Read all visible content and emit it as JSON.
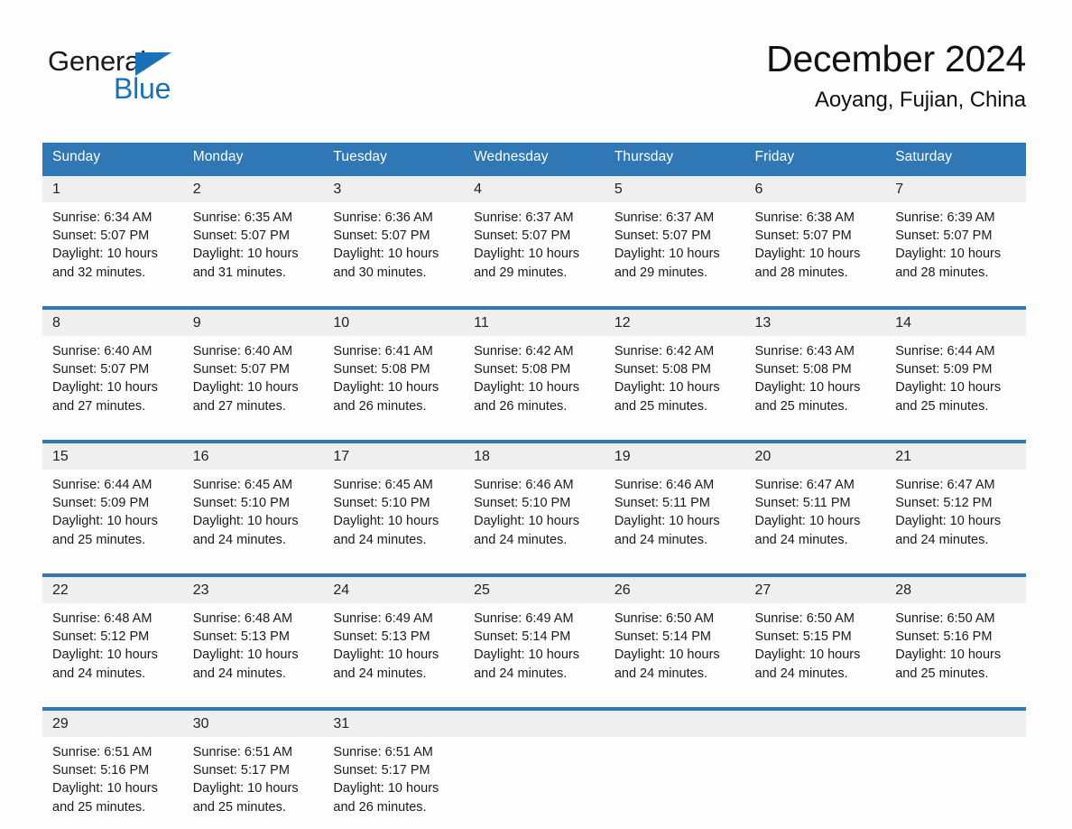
{
  "brand": {
    "name_part1": "General",
    "name_part2": "Blue",
    "accent_color": "#1a71b8"
  },
  "header": {
    "title": "December 2024",
    "location": "Aoyang, Fujian, China"
  },
  "calendar": {
    "header_bg_color": "#2f77b5",
    "daynum_bg_color": "#efefef",
    "weekdays": [
      "Sunday",
      "Monday",
      "Tuesday",
      "Wednesday",
      "Thursday",
      "Friday",
      "Saturday"
    ],
    "weeks": [
      [
        {
          "day": "1",
          "sunrise": "Sunrise: 6:34 AM",
          "sunset": "Sunset: 5:07 PM",
          "daylight": "Daylight: 10 hours and 32 minutes."
        },
        {
          "day": "2",
          "sunrise": "Sunrise: 6:35 AM",
          "sunset": "Sunset: 5:07 PM",
          "daylight": "Daylight: 10 hours and 31 minutes."
        },
        {
          "day": "3",
          "sunrise": "Sunrise: 6:36 AM",
          "sunset": "Sunset: 5:07 PM",
          "daylight": "Daylight: 10 hours and 30 minutes."
        },
        {
          "day": "4",
          "sunrise": "Sunrise: 6:37 AM",
          "sunset": "Sunset: 5:07 PM",
          "daylight": "Daylight: 10 hours and 29 minutes."
        },
        {
          "day": "5",
          "sunrise": "Sunrise: 6:37 AM",
          "sunset": "Sunset: 5:07 PM",
          "daylight": "Daylight: 10 hours and 29 minutes."
        },
        {
          "day": "6",
          "sunrise": "Sunrise: 6:38 AM",
          "sunset": "Sunset: 5:07 PM",
          "daylight": "Daylight: 10 hours and 28 minutes."
        },
        {
          "day": "7",
          "sunrise": "Sunrise: 6:39 AM",
          "sunset": "Sunset: 5:07 PM",
          "daylight": "Daylight: 10 hours and 28 minutes."
        }
      ],
      [
        {
          "day": "8",
          "sunrise": "Sunrise: 6:40 AM",
          "sunset": "Sunset: 5:07 PM",
          "daylight": "Daylight: 10 hours and 27 minutes."
        },
        {
          "day": "9",
          "sunrise": "Sunrise: 6:40 AM",
          "sunset": "Sunset: 5:07 PM",
          "daylight": "Daylight: 10 hours and 27 minutes."
        },
        {
          "day": "10",
          "sunrise": "Sunrise: 6:41 AM",
          "sunset": "Sunset: 5:08 PM",
          "daylight": "Daylight: 10 hours and 26 minutes."
        },
        {
          "day": "11",
          "sunrise": "Sunrise: 6:42 AM",
          "sunset": "Sunset: 5:08 PM",
          "daylight": "Daylight: 10 hours and 26 minutes."
        },
        {
          "day": "12",
          "sunrise": "Sunrise: 6:42 AM",
          "sunset": "Sunset: 5:08 PM",
          "daylight": "Daylight: 10 hours and 25 minutes."
        },
        {
          "day": "13",
          "sunrise": "Sunrise: 6:43 AM",
          "sunset": "Sunset: 5:08 PM",
          "daylight": "Daylight: 10 hours and 25 minutes."
        },
        {
          "day": "14",
          "sunrise": "Sunrise: 6:44 AM",
          "sunset": "Sunset: 5:09 PM",
          "daylight": "Daylight: 10 hours and 25 minutes."
        }
      ],
      [
        {
          "day": "15",
          "sunrise": "Sunrise: 6:44 AM",
          "sunset": "Sunset: 5:09 PM",
          "daylight": "Daylight: 10 hours and 25 minutes."
        },
        {
          "day": "16",
          "sunrise": "Sunrise: 6:45 AM",
          "sunset": "Sunset: 5:10 PM",
          "daylight": "Daylight: 10 hours and 24 minutes."
        },
        {
          "day": "17",
          "sunrise": "Sunrise: 6:45 AM",
          "sunset": "Sunset: 5:10 PM",
          "daylight": "Daylight: 10 hours and 24 minutes."
        },
        {
          "day": "18",
          "sunrise": "Sunrise: 6:46 AM",
          "sunset": "Sunset: 5:10 PM",
          "daylight": "Daylight: 10 hours and 24 minutes."
        },
        {
          "day": "19",
          "sunrise": "Sunrise: 6:46 AM",
          "sunset": "Sunset: 5:11 PM",
          "daylight": "Daylight: 10 hours and 24 minutes."
        },
        {
          "day": "20",
          "sunrise": "Sunrise: 6:47 AM",
          "sunset": "Sunset: 5:11 PM",
          "daylight": "Daylight: 10 hours and 24 minutes."
        },
        {
          "day": "21",
          "sunrise": "Sunrise: 6:47 AM",
          "sunset": "Sunset: 5:12 PM",
          "daylight": "Daylight: 10 hours and 24 minutes."
        }
      ],
      [
        {
          "day": "22",
          "sunrise": "Sunrise: 6:48 AM",
          "sunset": "Sunset: 5:12 PM",
          "daylight": "Daylight: 10 hours and 24 minutes."
        },
        {
          "day": "23",
          "sunrise": "Sunrise: 6:48 AM",
          "sunset": "Sunset: 5:13 PM",
          "daylight": "Daylight: 10 hours and 24 minutes."
        },
        {
          "day": "24",
          "sunrise": "Sunrise: 6:49 AM",
          "sunset": "Sunset: 5:13 PM",
          "daylight": "Daylight: 10 hours and 24 minutes."
        },
        {
          "day": "25",
          "sunrise": "Sunrise: 6:49 AM",
          "sunset": "Sunset: 5:14 PM",
          "daylight": "Daylight: 10 hours and 24 minutes."
        },
        {
          "day": "26",
          "sunrise": "Sunrise: 6:50 AM",
          "sunset": "Sunset: 5:14 PM",
          "daylight": "Daylight: 10 hours and 24 minutes."
        },
        {
          "day": "27",
          "sunrise": "Sunrise: 6:50 AM",
          "sunset": "Sunset: 5:15 PM",
          "daylight": "Daylight: 10 hours and 24 minutes."
        },
        {
          "day": "28",
          "sunrise": "Sunrise: 6:50 AM",
          "sunset": "Sunset: 5:16 PM",
          "daylight": "Daylight: 10 hours and 25 minutes."
        }
      ],
      [
        {
          "day": "29",
          "sunrise": "Sunrise: 6:51 AM",
          "sunset": "Sunset: 5:16 PM",
          "daylight": "Daylight: 10 hours and 25 minutes."
        },
        {
          "day": "30",
          "sunrise": "Sunrise: 6:51 AM",
          "sunset": "Sunset: 5:17 PM",
          "daylight": "Daylight: 10 hours and 25 minutes."
        },
        {
          "day": "31",
          "sunrise": "Sunrise: 6:51 AM",
          "sunset": "Sunset: 5:17 PM",
          "daylight": "Daylight: 10 hours and 26 minutes."
        },
        {
          "day": "",
          "sunrise": "",
          "sunset": "",
          "daylight": ""
        },
        {
          "day": "",
          "sunrise": "",
          "sunset": "",
          "daylight": ""
        },
        {
          "day": "",
          "sunrise": "",
          "sunset": "",
          "daylight": ""
        },
        {
          "day": "",
          "sunrise": "",
          "sunset": "",
          "daylight": ""
        }
      ]
    ]
  }
}
